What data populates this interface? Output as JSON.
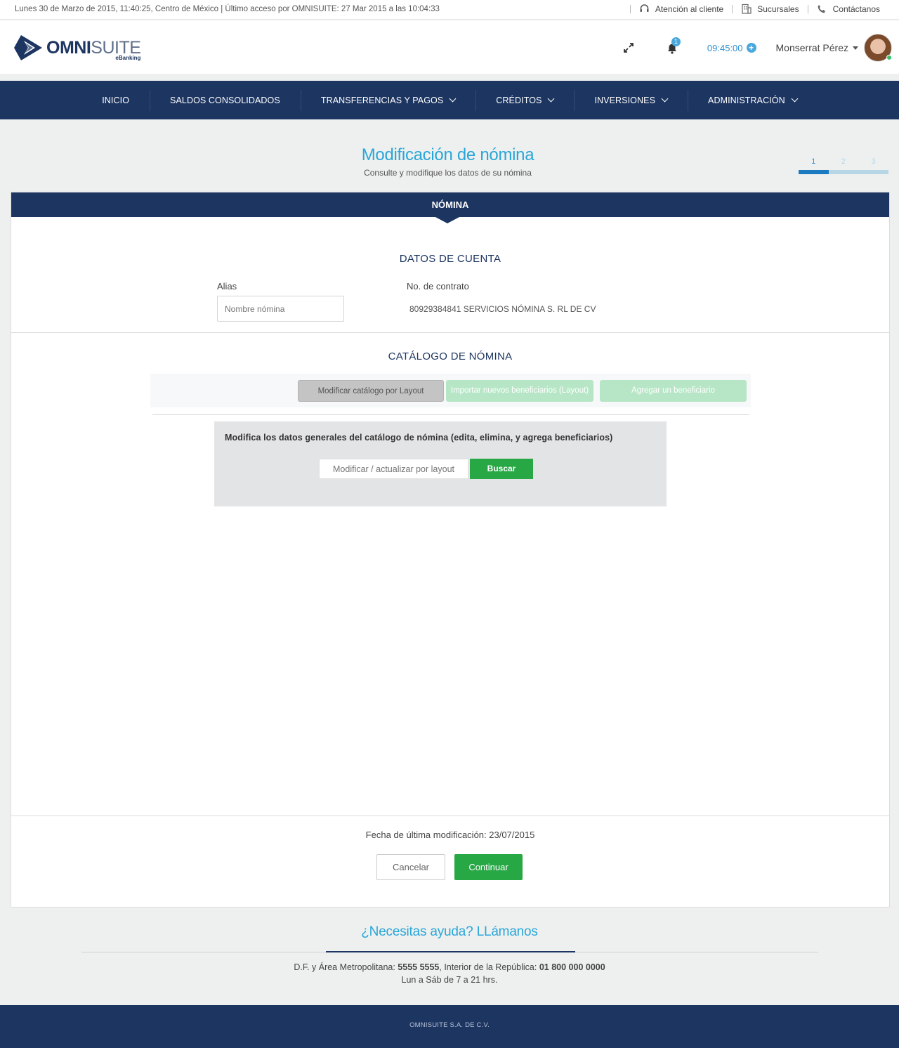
{
  "topbar": {
    "status": "Lunes 30 de Marzo de 2015, 11:40:25,  Centro de México | Último acceso por OMNISUITE: 27 Mar 2015 a las 10:04:33",
    "links": [
      {
        "label": "Atención al cliente",
        "icon": "headset-icon"
      },
      {
        "label": "Sucursales",
        "icon": "building-icon"
      },
      {
        "label": "Contáctanos",
        "icon": "phone-icon"
      }
    ]
  },
  "header": {
    "logo_bold": "OMNI",
    "logo_light": "SUITE",
    "logo_sub": "eBanking",
    "notifications_count": "1",
    "session_time": "09:45:00",
    "user_name": "Monserrat Pérez"
  },
  "nav": {
    "items": [
      {
        "label": "INICIO"
      },
      {
        "label": "SALDOS CONSOLIDADOS"
      },
      {
        "label": "TRANSFERENCIAS Y PAGOS"
      },
      {
        "label": "CRÉDITOS"
      },
      {
        "label": "INVERSIONES"
      },
      {
        "label": "ADMINISTRACIÓN"
      }
    ]
  },
  "page": {
    "title": "Modificación de nómina",
    "subtitle": "Consulte y modifique los datos de su nómina",
    "steps": [
      "1",
      "2",
      "3"
    ],
    "current_step": 1
  },
  "card": {
    "header": "NÓMINA",
    "datos_title": "DATOS DE CUENTA",
    "alias_label": "Alias",
    "alias_placeholder": "Nombre nómina",
    "contrato_label": "No. de contrato",
    "contrato_value": "80929384841 SERVICIOS NÓMINA S. RL  DE CV",
    "catalogo_title": "CATÁLOGO DE NÓMINA",
    "tabs": [
      "Modificar catálogo por Layout",
      "Importar nuevos beneficiarios (Layout)",
      "Agregar un  beneficiario"
    ],
    "panel_desc": "Modifica los datos generales del catálogo de nómina (edita, elimina, y agrega beneficiarios)",
    "file_placeholder": "Modificar / actualizar por layout",
    "buscar": "Buscar",
    "fecha": "Fecha de última modificación: 23/07/2015",
    "cancel": "Cancelar",
    "continue": "Continuar"
  },
  "help": {
    "title": "¿Necesitas ayuda? LLámanos",
    "line1_a": "D.F. y Área Metropolitana: ",
    "line1_b": "5555 5555",
    "line1_c": ", Interior de la República: ",
    "line1_d": "01 800 000 0000",
    "line2": "Lun a Sáb de 7 a 21 hrs."
  },
  "footer": "OMNISUITE S.A. DE C.V.",
  "colors": {
    "navy": "#1d3561",
    "accent_blue": "#29a6d8",
    "green": "#27a845"
  }
}
